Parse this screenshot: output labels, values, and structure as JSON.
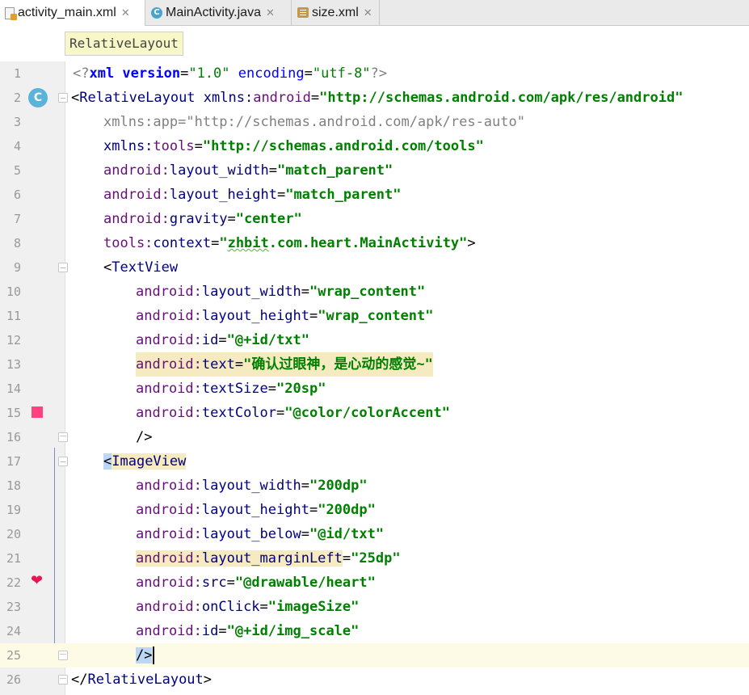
{
  "tabs": [
    {
      "label": "activity_main.xml",
      "icon": "xml-file-icon",
      "active": true
    },
    {
      "label": "MainActivity.java",
      "icon": "java-class-icon",
      "active": false
    },
    {
      "label": "size.xml",
      "icon": "values-file-icon",
      "active": false
    }
  ],
  "breadcrumb": "RelativeLayout",
  "gutter_icons": {
    "line2": "class-icon",
    "line2_text": "C",
    "line15": "color-swatch-icon",
    "line15_color": "#FF4081",
    "line22": "heart-drawable-icon",
    "line22_glyph": "❤"
  },
  "lines": [
    {
      "n": "1"
    },
    {
      "n": "2"
    },
    {
      "n": "3"
    },
    {
      "n": "4"
    },
    {
      "n": "5"
    },
    {
      "n": "6"
    },
    {
      "n": "7"
    },
    {
      "n": "8"
    },
    {
      "n": "9"
    },
    {
      "n": "10"
    },
    {
      "n": "11"
    },
    {
      "n": "12"
    },
    {
      "n": "13"
    },
    {
      "n": "14"
    },
    {
      "n": "15"
    },
    {
      "n": "16"
    },
    {
      "n": "17"
    },
    {
      "n": "18"
    },
    {
      "n": "19"
    },
    {
      "n": "20"
    },
    {
      "n": "21"
    },
    {
      "n": "22"
    },
    {
      "n": "23"
    },
    {
      "n": "24"
    },
    {
      "n": "25"
    },
    {
      "n": "26"
    }
  ],
  "code": {
    "l1": {
      "p1": "<?",
      "p2": "xml version",
      "p3": "=",
      "p4": "\"1.0\"",
      "p5": " encoding",
      "p6": "=",
      "p7": "\"utf-8\"",
      "p8": "?>"
    },
    "l2": {
      "open": "<",
      "tag": "RelativeLayout",
      "ns": " xmlns:",
      "attr": "android",
      "eq": "=",
      "val": "\"http://schemas.android.com/apk/res/android\""
    },
    "l3": {
      "text": "xmlns:app=\"http://schemas.android.com/apk/res-auto\""
    },
    "l4": {
      "ns": "xmlns:",
      "attr": "tools",
      "eq": "=",
      "val": "\"http://schemas.android.com/tools\""
    },
    "l5": {
      "ns": "android:",
      "attr": "layout_width",
      "eq": "=",
      "val": "\"match_parent\""
    },
    "l6": {
      "ns": "android:",
      "attr": "layout_height",
      "eq": "=",
      "val": "\"match_parent\""
    },
    "l7": {
      "ns": "android:",
      "attr": "gravity",
      "eq": "=",
      "val": "\"center\""
    },
    "l8": {
      "ns": "tools:",
      "attr": "context",
      "eq": "=",
      "q": "\"",
      "v1": "zhbit",
      "v2": ".com.heart.MainActivity\"",
      "close": ">"
    },
    "l9": {
      "open": "<",
      "tag": "TextView"
    },
    "l10": {
      "ns": "android:",
      "attr": "layout_width",
      "eq": "=",
      "val": "\"wrap_content\""
    },
    "l11": {
      "ns": "android:",
      "attr": "layout_height",
      "eq": "=",
      "val": "\"wrap_content\""
    },
    "l12": {
      "ns": "android:",
      "attr": "id",
      "eq": "=",
      "val": "\"@+id/txt\""
    },
    "l13": {
      "ns": "android:",
      "attr": "text",
      "eq": "=",
      "val": "\"确认过眼神，是心动的感觉~\""
    },
    "l14": {
      "ns": "android:",
      "attr": "textSize",
      "eq": "=",
      "val": "\"20sp\""
    },
    "l15": {
      "ns": "android:",
      "attr": "textColor",
      "eq": "=",
      "val": "\"@color/colorAccent\""
    },
    "l16": {
      "text": "/>"
    },
    "l17": {
      "open": "<",
      "tag": "ImageView"
    },
    "l18": {
      "ns": "android:",
      "attr": "layout_width",
      "eq": "=",
      "val": "\"200dp\""
    },
    "l19": {
      "ns": "android:",
      "attr": "layout_height",
      "eq": "=",
      "val": "\"200dp\""
    },
    "l20": {
      "ns": "android:",
      "attr": "layout_below",
      "eq": "=",
      "val": "\"@id/txt\""
    },
    "l21": {
      "ns": "android:",
      "attr": "layout_marginLeft",
      "eq": "=",
      "val": "\"25dp\""
    },
    "l22": {
      "ns": "android:",
      "attr": "src",
      "eq": "=",
      "val": "\"@drawable/heart\""
    },
    "l23": {
      "ns": "android:",
      "attr": "onClick",
      "eq": "=",
      "val": "\"imageSize\""
    },
    "l24": {
      "ns": "android:",
      "attr": "id",
      "eq": "=",
      "val": "\"@+id/img_scale\""
    },
    "l25": {
      "text": "/>"
    },
    "l26": {
      "open": "</",
      "tag": "RelativeLayout",
      "close": ">"
    }
  }
}
